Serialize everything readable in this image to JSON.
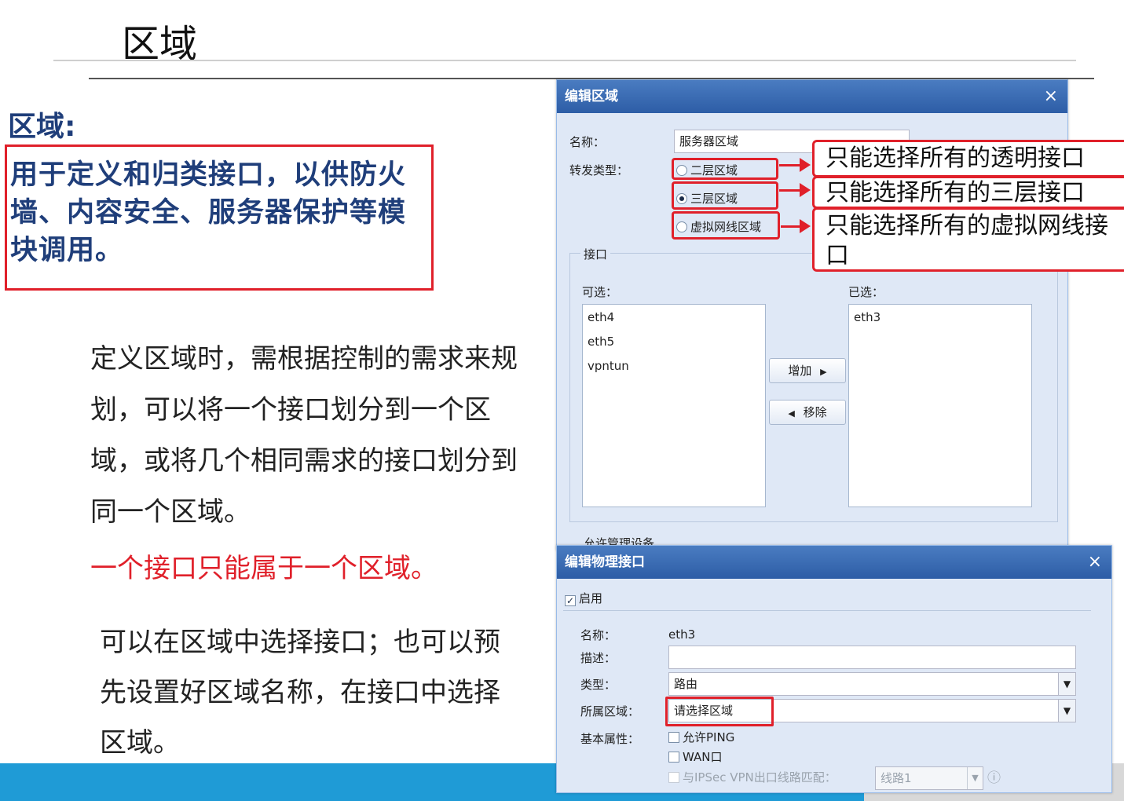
{
  "slide": {
    "title": "区域",
    "definition_heading": "区域:",
    "definition_text": "用于定义和归类接口，以供防火墙、内容安全、服务器保护等模块调用。",
    "paragraph1": "定义区域时，需根据控制的需求来规划，可以将一个接口划分到一个区域，或将几个相同需求的接口划分到同一个区域。",
    "paragraph_red": "一个接口只能属于一个区域。",
    "paragraph2": "可以在区域中选择接口；也可以预先设置好区域名称，在接口中选择区域。"
  },
  "edit_zone": {
    "title": "编辑区域",
    "close": "×",
    "name_label": "名称：",
    "name_value": "服务器区域",
    "forward_type_label": "转发类型：",
    "options": [
      {
        "label": "二层区域",
        "selected": false
      },
      {
        "label": "三层区域",
        "selected": true
      },
      {
        "label": "虚拟网线区域",
        "selected": false
      }
    ],
    "interface_legend": "接口",
    "available_label": "可选：",
    "selected_label": "已选：",
    "available_items": [
      "eth4",
      "eth5",
      "vpntun"
    ],
    "selected_items": [
      "eth3"
    ],
    "add_button": "增加",
    "remove_button": "移除",
    "clipped_legend": "允许管理设备"
  },
  "callouts": [
    "只能选择所有的透明接口",
    "只能选择所有的三层接口",
    "只能选择所有的虚拟网线接口"
  ],
  "edit_physical": {
    "title": "编辑物理接口",
    "close": "×",
    "enable_label": "启用",
    "name_label": "名称：",
    "name_value": "eth3",
    "desc_label": "描述：",
    "type_label": "类型：",
    "type_value": "路由",
    "zone_label": "所属区域：",
    "zone_value": "请选择区域",
    "attr_label": "基本属性：",
    "allow_ping": "允许PING",
    "wan": "WAN口",
    "ipsec_label": "与IPSec VPN出口线路匹配：",
    "line_value": "线路1",
    "info_icon": "ⓘ"
  },
  "colors": {
    "accent_red": "#e0202a",
    "heading_blue": "#1f3e7a",
    "band_blue": "#1f9bd6"
  }
}
